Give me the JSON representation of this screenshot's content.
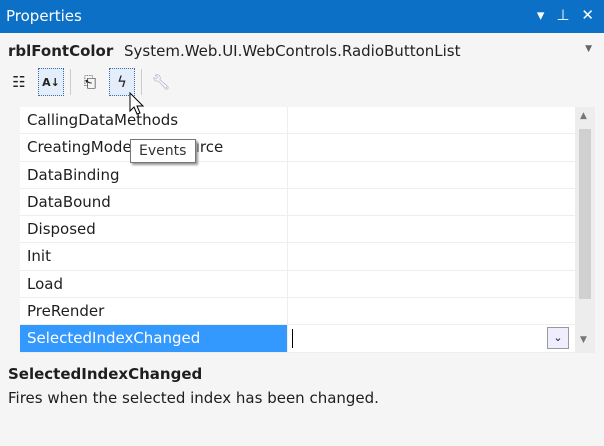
{
  "window": {
    "title": "Properties"
  },
  "object": {
    "name": "rblFontColor",
    "type": "System.Web.UI.WebControls.RadioButtonList"
  },
  "toolbar": {
    "tooltip": "Events"
  },
  "events": [
    {
      "name": "CallingDataMethods"
    },
    {
      "name": "CreatingModelDataSource"
    },
    {
      "name": "DataBinding"
    },
    {
      "name": "DataBound"
    },
    {
      "name": "Disposed"
    },
    {
      "name": "Init"
    },
    {
      "name": "Load"
    },
    {
      "name": "PreRender"
    },
    {
      "name": "SelectedIndexChanged",
      "value": ""
    }
  ],
  "description": {
    "title": "SelectedIndexChanged",
    "text": "Fires when the selected index has been changed."
  }
}
